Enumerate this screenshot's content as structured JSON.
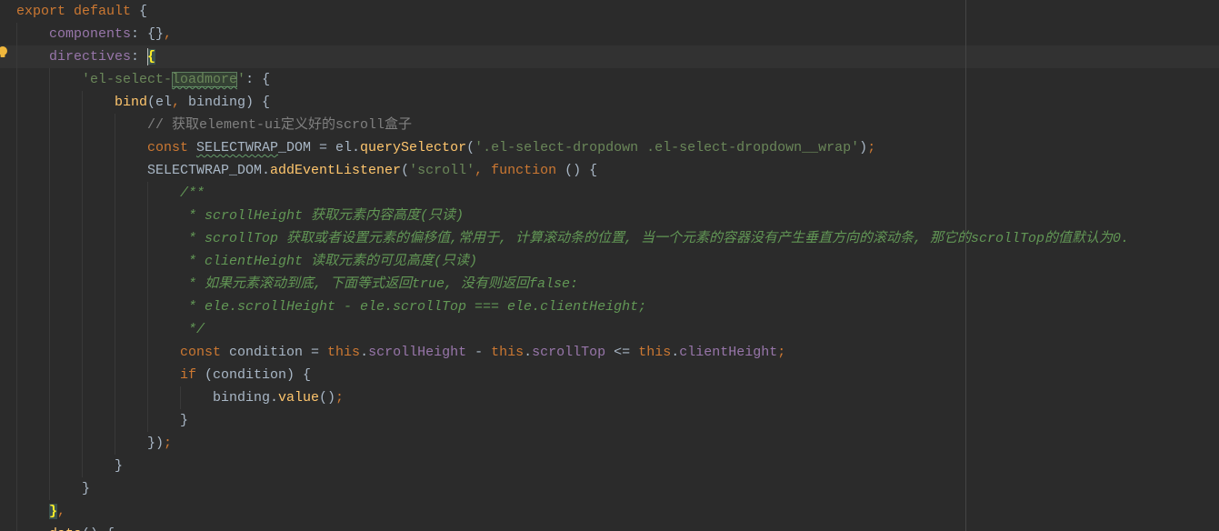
{
  "editor": {
    "colors": {
      "background": "#2B2B2B",
      "current_line": "#323232",
      "text": "#A9B7C6",
      "keyword": "#CC7832",
      "property": "#9876AA",
      "string": "#6A8759",
      "function": "#FFC66D",
      "line_comment": "#808080",
      "doc_comment": "#629755",
      "brace_match_text": "#FFEF28",
      "brace_match_background": "#3B514D",
      "identifier_highlight": "#344134",
      "identifier_highlight_border": "#5E7F5E",
      "typo_underline": "#659C6B",
      "indent_guide": "#393939",
      "right_margin": "#444444",
      "caret": "#BBBBBB",
      "lightbulb": "#F0B73C"
    },
    "gutter": {
      "intention_icon": "lightbulb-icon"
    },
    "lines": [
      [
        "export default",
        " {"
      ],
      [
        "components",
        ": {}",
        ","
      ],
      [
        "directives",
        ": ",
        "{"
      ],
      [
        "'el-select-",
        "loadmore",
        "'",
        ": {"
      ],
      [
        "bind",
        "(el",
        ",",
        " binding) {"
      ],
      [
        "// 获取element-ui定义好的scroll盒子"
      ],
      [
        "const ",
        "SELECTWRAP",
        "_DOM = el.",
        "querySelector",
        "(",
        "'.el-select-dropdown .el-select-dropdown__wrap'",
        ")",
        ";"
      ],
      [
        "SELECTWRAP_DOM.",
        "addEventListener",
        "(",
        "'scroll'",
        ",",
        " function",
        " () {"
      ],
      [
        "/**"
      ],
      [
        " * scrollHeight 获取元素内容高度(只读)"
      ],
      [
        " * scrollTop 获取或者设置元素的偏移值,常用于, 计算滚动条的位置, 当一个元素的容器没有产生垂直方向的滚动条, 那它的scrollTop的值默认为0."
      ],
      [
        " * clientHeight 读取元素的可见高度(只读)"
      ],
      [
        " * 如果元素滚动到底, 下面等式返回true, 没有则返回false:"
      ],
      [
        " * ele.scrollHeight - ele.scrollTop === ele.clientHeight;"
      ],
      [
        " */"
      ],
      [
        "const",
        " condition = ",
        "this",
        ".",
        "scrollHeight",
        " - ",
        "this",
        ".",
        "scrollTop",
        " <= ",
        "this",
        ".",
        "clientHeight",
        ";"
      ],
      [
        "if",
        " (condition) {"
      ],
      [
        "binding.",
        "value",
        "()",
        ";"
      ],
      [
        "}"
      ],
      [
        "})",
        ";"
      ],
      [
        "}"
      ],
      [
        "}"
      ],
      [
        "}",
        ","
      ],
      [
        "data",
        "() {"
      ]
    ]
  }
}
